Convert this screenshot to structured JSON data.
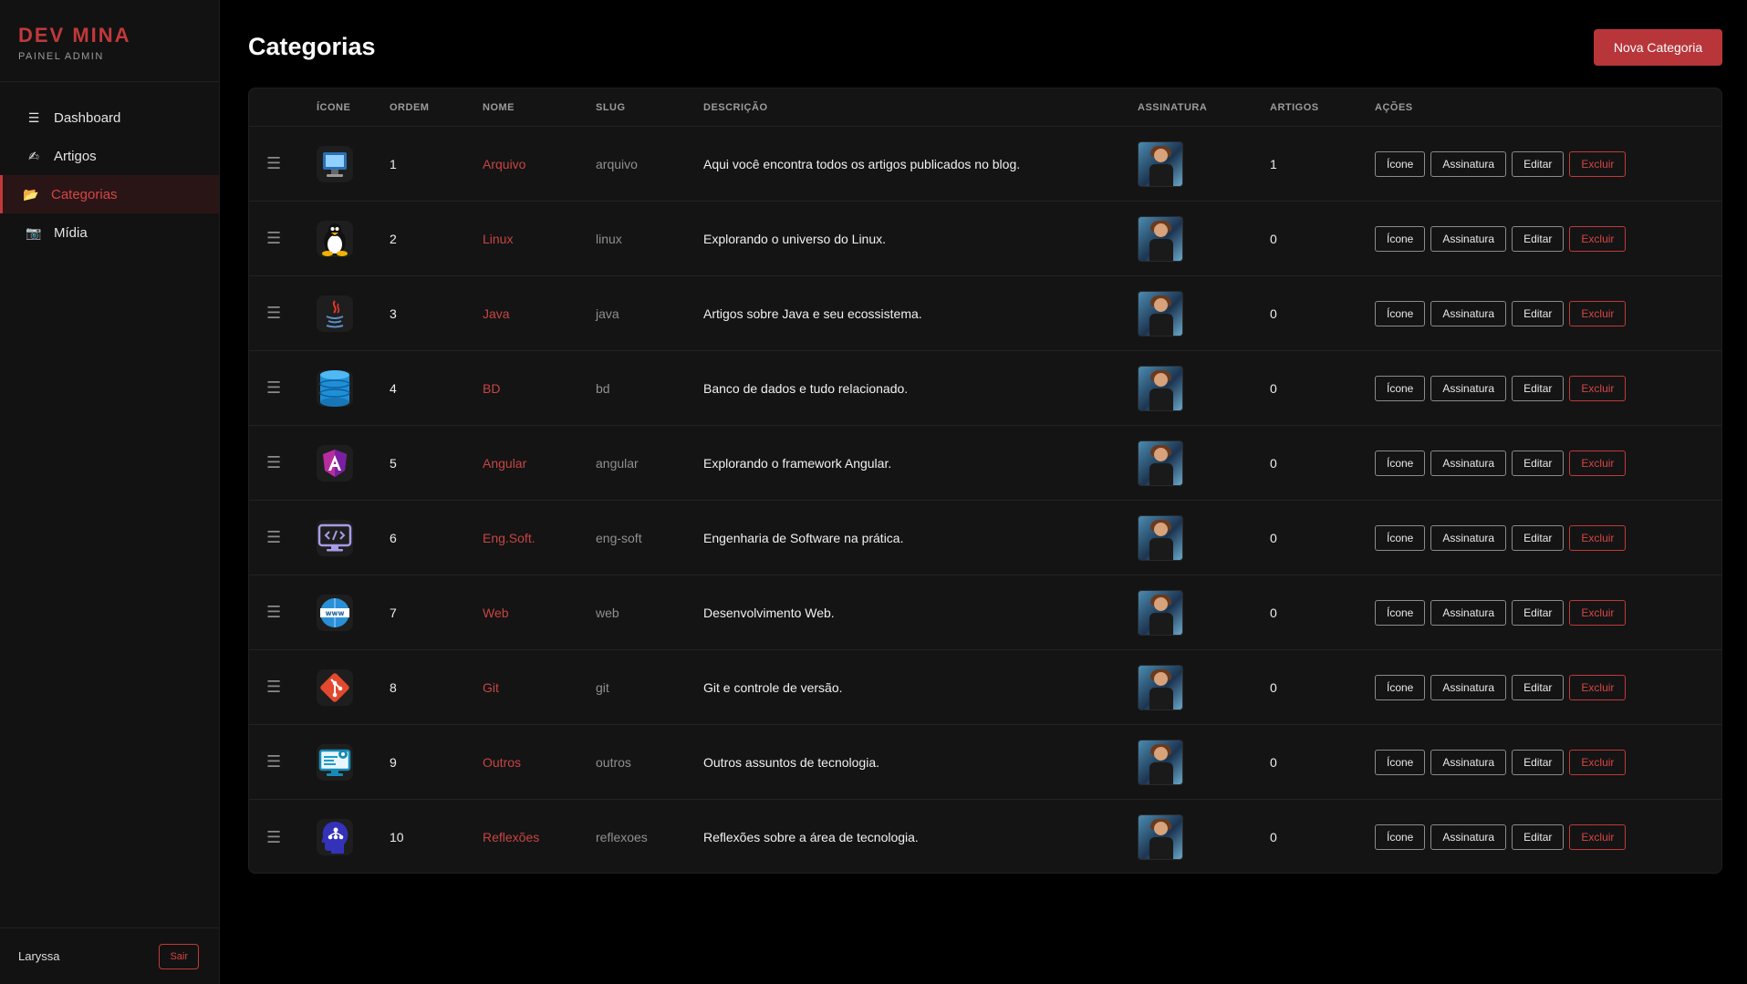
{
  "sidebar": {
    "brand": "DEV MINA",
    "subtitle": "PAINEL ADMIN",
    "items": [
      {
        "label": "Dashboard",
        "icon": "☰"
      },
      {
        "label": "Artigos",
        "icon": "✍"
      },
      {
        "label": "Categorias",
        "icon": "📂"
      },
      {
        "label": "Mídia",
        "icon": "📷"
      }
    ],
    "user": "Laryssa",
    "logout": "Sair"
  },
  "header": {
    "title": "Categorias",
    "new_button": "Nova Categoria"
  },
  "table": {
    "columns": [
      "ÍCONE",
      "ORDEM",
      "NOME",
      "SLUG",
      "DESCRIÇÃO",
      "ASSINATURA",
      "ARTIGOS",
      "AÇÕES"
    ],
    "actions": {
      "icon": "Ícone",
      "signature": "Assinatura",
      "edit": "Editar",
      "delete": "Excluir"
    },
    "rows": [
      {
        "ordem": "1",
        "nome": "Arquivo",
        "slug": "arquivo",
        "descricao": "Aqui você encontra todos os artigos publicados no blog.",
        "artigos": "1",
        "icon": "computer-icon"
      },
      {
        "ordem": "2",
        "nome": "Linux",
        "slug": "linux",
        "descricao": "Explorando o universo do Linux.",
        "artigos": "0",
        "icon": "tux-penguin-icon"
      },
      {
        "ordem": "3",
        "nome": "Java",
        "slug": "java",
        "descricao": "Artigos sobre Java e seu ecossistema.",
        "artigos": "0",
        "icon": "java-coffee-icon"
      },
      {
        "ordem": "4",
        "nome": "BD",
        "slug": "bd",
        "descricao": "Banco de dados e tudo relacionado.",
        "artigos": "0",
        "icon": "database-icon"
      },
      {
        "ordem": "5",
        "nome": "Angular",
        "slug": "angular",
        "descricao": "Explorando o framework Angular.",
        "artigos": "0",
        "icon": "angular-icon"
      },
      {
        "ordem": "6",
        "nome": "Eng.Soft.",
        "slug": "eng-soft",
        "descricao": "Engenharia de Software na prática.",
        "artigos": "0",
        "icon": "code-monitor-icon"
      },
      {
        "ordem": "7",
        "nome": "Web",
        "slug": "web",
        "descricao": "Desenvolvimento Web.",
        "artigos": "0",
        "icon": "www-globe-icon"
      },
      {
        "ordem": "8",
        "nome": "Git",
        "slug": "git",
        "descricao": "Git e controle de versão.",
        "artigos": "0",
        "icon": "git-icon"
      },
      {
        "ordem": "9",
        "nome": "Outros",
        "slug": "outros",
        "descricao": "Outros assuntos de tecnologia.",
        "artigos": "0",
        "icon": "settings-monitor-icon"
      },
      {
        "ordem": "10",
        "nome": "Reflexões",
        "slug": "reflexoes",
        "descricao": "Reflexões sobre a área de tecnologia.",
        "artigos": "0",
        "icon": "head-network-icon"
      }
    ]
  },
  "colors": {
    "accent": "#c0393b",
    "background": "#000000",
    "sidebar": "#121212",
    "card": "#141414"
  }
}
